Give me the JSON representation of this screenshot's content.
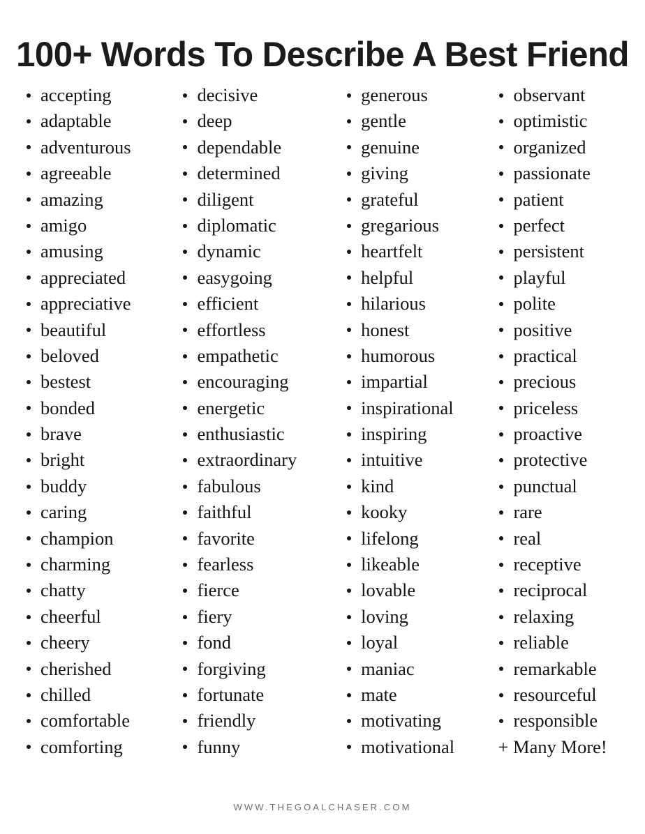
{
  "page": {
    "title": "100+ Words To Describe A Best Friend",
    "background_color": "#ffffff",
    "text_color": "#151515",
    "footer_color": "#6f6f73"
  },
  "footer": {
    "site_url": "WWW.THEGOALCHASER.COM"
  },
  "word_list": {
    "total_label": "100+",
    "closing_note": "+ Many More!",
    "columns": [
      {
        "name": "column-1",
        "items": [
          "accepting",
          "adaptable",
          "adventurous",
          "agreeable",
          "amazing",
          "amigo",
          "amusing",
          "appreciated",
          "appreciative",
          "beautiful",
          "beloved",
          "bestest",
          "bonded",
          "brave",
          "bright",
          "buddy",
          "caring",
          "champion",
          "charming",
          "chatty",
          "cheerful",
          "cheery",
          "cherished",
          "chilled",
          "comfortable",
          "comforting"
        ]
      },
      {
        "name": "column-2",
        "items": [
          "decisive",
          "deep",
          "dependable",
          "determined",
          "diligent",
          "diplomatic",
          "dynamic",
          "easygoing",
          "efficient",
          "effortless",
          "empathetic",
          "encouraging",
          "energetic",
          "enthusiastic",
          "extraordinary",
          "fabulous",
          "faithful",
          "favorite",
          "fearless",
          "fierce",
          "fiery",
          "fond",
          "forgiving",
          "fortunate",
          "friendly",
          "funny"
        ]
      },
      {
        "name": "column-3",
        "items": [
          "generous",
          "gentle",
          "genuine",
          "giving",
          "grateful",
          "gregarious",
          "heartfelt",
          "helpful",
          "hilarious",
          "honest",
          "humorous",
          "impartial",
          "inspirational",
          "inspiring",
          "intuitive",
          "kind",
          "kooky",
          "lifelong",
          "likeable",
          "lovable",
          "loving",
          "loyal",
          "maniac",
          "mate",
          "motivating",
          "motivational"
        ]
      },
      {
        "name": "column-4",
        "items": [
          "observant",
          "optimistic",
          "organized",
          "passionate",
          "patient",
          "perfect",
          "persistent",
          "playful",
          "polite",
          "positive",
          "practical",
          "precious",
          "priceless",
          "proactive",
          "protective",
          "punctual",
          "rare",
          "real",
          "receptive",
          "reciprocal",
          "relaxing",
          "reliable",
          "remarkable",
          "resourceful",
          "responsible"
        ],
        "trailing_note": "+ Many More!"
      }
    ]
  }
}
